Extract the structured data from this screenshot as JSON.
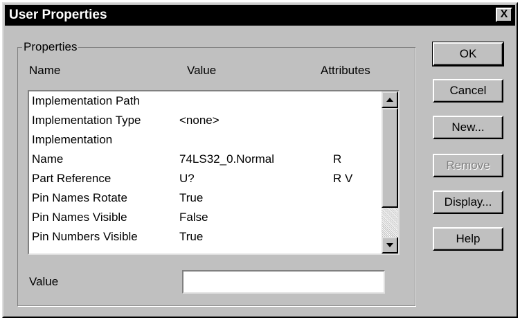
{
  "window": {
    "title": "User Properties",
    "close_label": "X"
  },
  "properties": {
    "legend": "Properties",
    "columns": {
      "name": "Name",
      "value": "Value",
      "attributes": "Attributes"
    },
    "rows": [
      {
        "name": "Implementation Path",
        "value": "",
        "attributes": ""
      },
      {
        "name": "Implementation Type",
        "value": "<none>",
        "attributes": ""
      },
      {
        "name": "Implementation",
        "value": "",
        "attributes": ""
      },
      {
        "name": "Name",
        "value": "74LS32_0.Normal",
        "attributes": "R"
      },
      {
        "name": "Part Reference",
        "value": "U?",
        "attributes": "R V"
      },
      {
        "name": "Pin Names Rotate",
        "value": "True",
        "attributes": ""
      },
      {
        "name": "Pin Names Visible",
        "value": "False",
        "attributes": ""
      },
      {
        "name": "Pin Numbers Visible",
        "value": "True",
        "attributes": ""
      }
    ]
  },
  "value_field": {
    "label": "Value",
    "value": ""
  },
  "buttons": {
    "ok": "OK",
    "cancel": "Cancel",
    "new": "New...",
    "remove": "Remove",
    "display": "Display...",
    "help": "Help"
  },
  "icons": {
    "close": "close-icon",
    "scroll_up": "arrow-up-icon",
    "scroll_down": "arrow-down-icon"
  }
}
